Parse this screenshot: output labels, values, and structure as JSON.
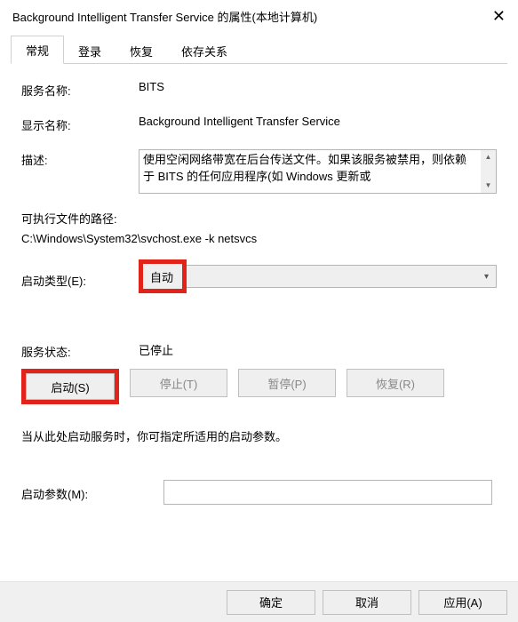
{
  "title": "Background Intelligent Transfer Service 的属性(本地计算机)",
  "tabs": {
    "general": "常规",
    "logon": "登录",
    "recovery": "恢复",
    "dependencies": "依存关系"
  },
  "labels": {
    "service_name": "服务名称:",
    "display_name": "显示名称:",
    "description": "描述:",
    "exe_path": "可执行文件的路径:",
    "startup_type": "启动类型(E):",
    "service_status": "服务状态:",
    "start_hint": "当从此处启动服务时，你可指定所适用的启动参数。",
    "start_params": "启动参数(M):"
  },
  "values": {
    "service_name": "BITS",
    "display_name": "Background Intelligent Transfer Service",
    "description": "使用空闲网络带宽在后台传送文件。如果该服务被禁用，则依赖于 BITS 的任何应用程序(如 Windows 更新或",
    "exe_path": "C:\\Windows\\System32\\svchost.exe -k netsvcs",
    "startup_type": "自动",
    "service_status": "已停止",
    "start_params": ""
  },
  "buttons": {
    "start": "启动(S)",
    "stop": "停止(T)",
    "pause": "暂停(P)",
    "resume": "恢复(R)",
    "ok": "确定",
    "cancel": "取消",
    "apply": "应用(A)"
  }
}
